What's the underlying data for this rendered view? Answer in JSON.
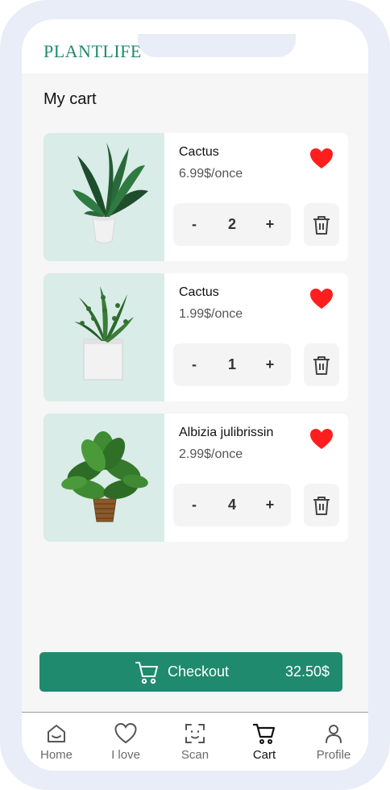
{
  "app": {
    "brand": "PLANTLIFE",
    "page_title": "My cart"
  },
  "cart": {
    "items": [
      {
        "name": "Cactus",
        "price": "6.99$/once",
        "quantity": "2",
        "minus": "-",
        "plus": "+",
        "favorite_icon": "heart-filled-icon",
        "delete_icon": "trash-icon"
      },
      {
        "name": "Cactus",
        "price": "1.99$/once",
        "quantity": "1",
        "minus": "-",
        "plus": "+",
        "favorite_icon": "heart-filled-icon",
        "delete_icon": "trash-icon"
      },
      {
        "name": "Albizia julibrissin",
        "price": "2.99$/once",
        "quantity": "4",
        "minus": "-",
        "plus": "+",
        "favorite_icon": "heart-filled-icon",
        "delete_icon": "trash-icon"
      }
    ]
  },
  "checkout": {
    "label": "Checkout",
    "total": "32.50$",
    "icon": "cart-icon"
  },
  "nav": {
    "items": [
      {
        "label": "Home",
        "icon": "home-icon",
        "active": false
      },
      {
        "label": "I love",
        "icon": "heart-outline-icon",
        "active": false
      },
      {
        "label": "Scan",
        "icon": "scan-icon",
        "active": false
      },
      {
        "label": "Cart",
        "icon": "cart-icon",
        "active": true
      },
      {
        "label": "Profile",
        "icon": "profile-icon",
        "active": false
      }
    ]
  },
  "colors": {
    "accent": "#1f8a6e",
    "favorite": "#ff1e1e",
    "frame": "#e8edf8",
    "image_bg": "#d9ece8",
    "screen_bg": "#f6f6f6"
  }
}
